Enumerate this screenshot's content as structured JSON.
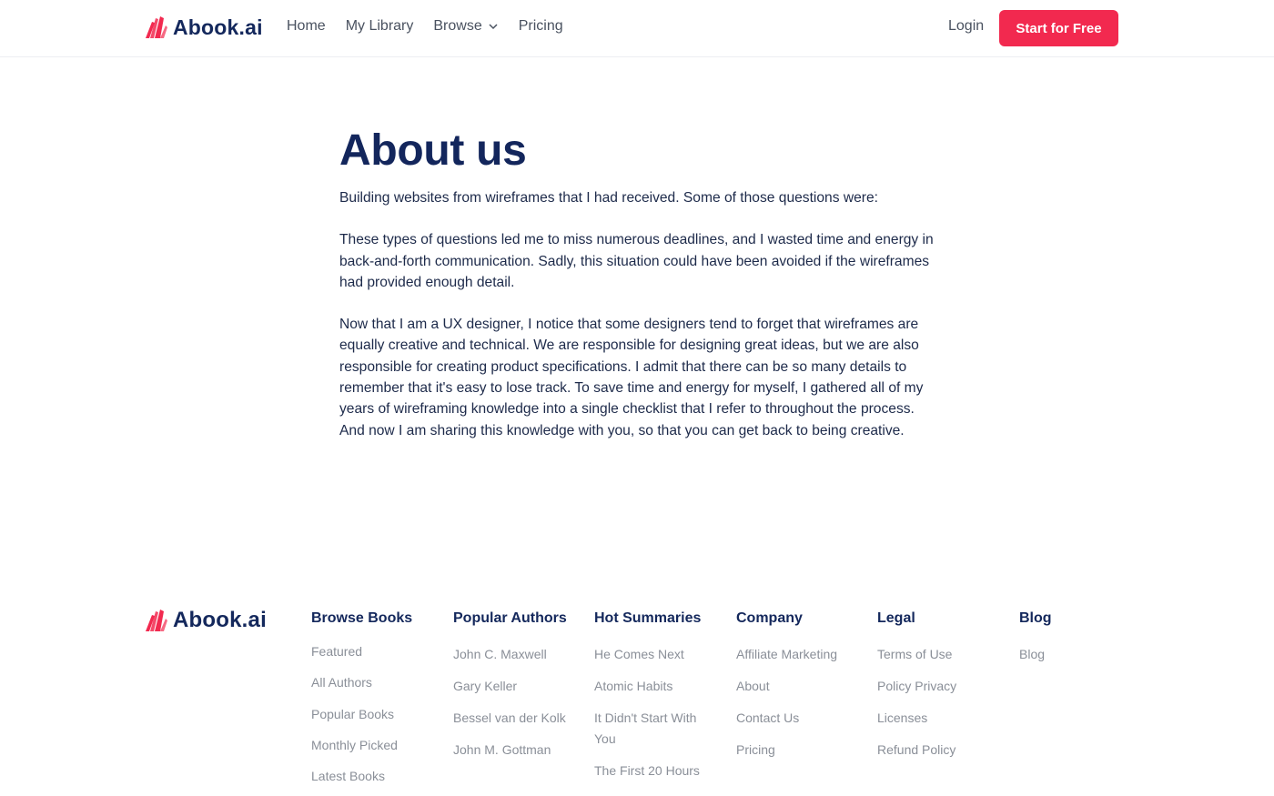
{
  "brand": {
    "name": "Abook.ai",
    "logo_icon": "book-pages-logo"
  },
  "nav": {
    "items": [
      {
        "label": "Home"
      },
      {
        "label": "My Library"
      },
      {
        "label": "Browse",
        "dropdown": true
      },
      {
        "label": "Pricing"
      }
    ],
    "login": "Login",
    "cta": "Start for Free"
  },
  "about": {
    "title": "About us",
    "paragraphs": [
      "Building websites from wireframes that I had received. Some of those questions were:",
      "These types of questions led me to miss numerous deadlines, and I wasted time and energy in back-and-forth communication. Sadly, this situation could have been avoided if the wireframes had provided enough detail.",
      "Now that I am a UX designer, I notice that some designers tend to forget that wireframes are equally creative and technical. We are responsible for designing great ideas, but we are also responsible for creating product specifications. I admit that there can be so many details to remember that it's easy to lose track. To save time and energy for myself, I gathered all of my years of wireframing knowledge into a single checklist that I refer to throughout the process. And now I am sharing this knowledge with you, so that you can get back to being creative."
    ]
  },
  "footer": {
    "brand": "Abook.ai",
    "columns": [
      {
        "title": "Browse Books",
        "links": [
          "Featured",
          "All Authors",
          "Popular Books",
          "Monthly Picked",
          "Latest Books"
        ]
      },
      {
        "title": "Popular Authors",
        "links": [
          "John C. Maxwell",
          "Gary Keller",
          "Bessel van der Kolk",
          "John M. Gottman"
        ]
      },
      {
        "title": "Hot Summaries",
        "links": [
          "He Comes Next",
          "Atomic Habits",
          "It Didn't Start With You",
          "The First 20 Hours"
        ]
      },
      {
        "title": "Company",
        "links": [
          "Affiliate Marketing",
          "About",
          "Contact Us",
          "Pricing"
        ]
      },
      {
        "title": "Legal",
        "links": [
          "Terms of Use",
          "Policy Privacy",
          "Licenses",
          "Refund Policy"
        ]
      },
      {
        "title": "Blog",
        "links": [
          "Blog"
        ]
      }
    ]
  },
  "colors": {
    "brand_navy": "#14285c",
    "accent_red": "#f2294f",
    "muted_text": "#8a8f98"
  }
}
